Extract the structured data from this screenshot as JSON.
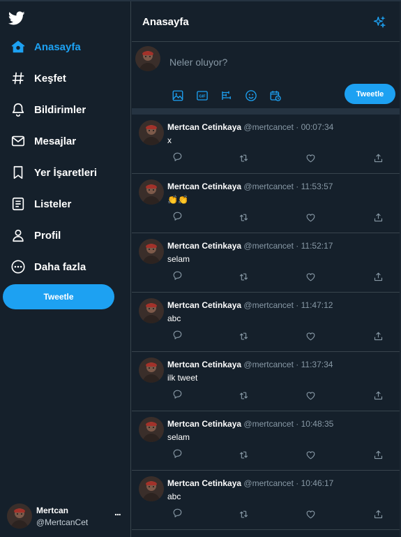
{
  "app": {
    "logo_icon": "twitter-bird-icon",
    "accent": "#1da1f2",
    "background": "#15202b"
  },
  "sidebar": {
    "items": [
      {
        "label": "Anasayfa",
        "icon": "home-icon",
        "active": true
      },
      {
        "label": "Keşfet",
        "icon": "hashtag-icon",
        "active": false
      },
      {
        "label": "Bildirimler",
        "icon": "bell-icon",
        "active": false
      },
      {
        "label": "Mesajlar",
        "icon": "mail-icon",
        "active": false
      },
      {
        "label": "Yer İşaretleri",
        "icon": "bookmark-icon",
        "active": false
      },
      {
        "label": "Listeler",
        "icon": "list-icon",
        "active": false
      },
      {
        "label": "Profil",
        "icon": "user-icon",
        "active": false
      },
      {
        "label": "Daha fazla",
        "icon": "more-circle-icon",
        "active": false
      }
    ],
    "tweet_button": "Tweetle",
    "profile": {
      "name": "Mertcan",
      "handle": "@MertcanCet",
      "more": "..."
    }
  },
  "main": {
    "header": {
      "title": "Anasayfa",
      "icon": "sparkle-icon"
    },
    "composer": {
      "placeholder": "Neler oluyor?",
      "tools": [
        "image-icon",
        "gif-icon",
        "poll-icon",
        "emoji-icon",
        "schedule-icon"
      ],
      "tweet_button": "Tweetle"
    },
    "tweets": [
      {
        "name": "Mertcan Cetinkaya",
        "handle": "@mertcancet",
        "dot": "·",
        "time": "00:07:34",
        "text": "x"
      },
      {
        "name": "Mertcan Cetinkaya",
        "handle": "@mertcancet",
        "dot": "·",
        "time": "11:53:57",
        "text": "👏👏"
      },
      {
        "name": "Mertcan Cetinkaya",
        "handle": "@mertcancet",
        "dot": "·",
        "time": "11:52:17",
        "text": "selam"
      },
      {
        "name": "Mertcan Cetinkaya",
        "handle": "@mertcancet",
        "dot": "·",
        "time": "11:47:12",
        "text": "abc"
      },
      {
        "name": "Mertcan Cetinkaya",
        "handle": "@mertcancet",
        "dot": "·",
        "time": "11:37:34",
        "text": "ilk tweet"
      },
      {
        "name": "Mertcan Cetinkaya",
        "handle": "@mertcancet",
        "dot": "·",
        "time": "10:48:35",
        "text": "selam"
      },
      {
        "name": "Mertcan Cetinkaya",
        "handle": "@mertcancet",
        "dot": "·",
        "time": "10:46:17",
        "text": "abc"
      }
    ],
    "tweet_actions": [
      "reply-icon",
      "retweet-icon",
      "like-icon",
      "share-icon"
    ]
  }
}
